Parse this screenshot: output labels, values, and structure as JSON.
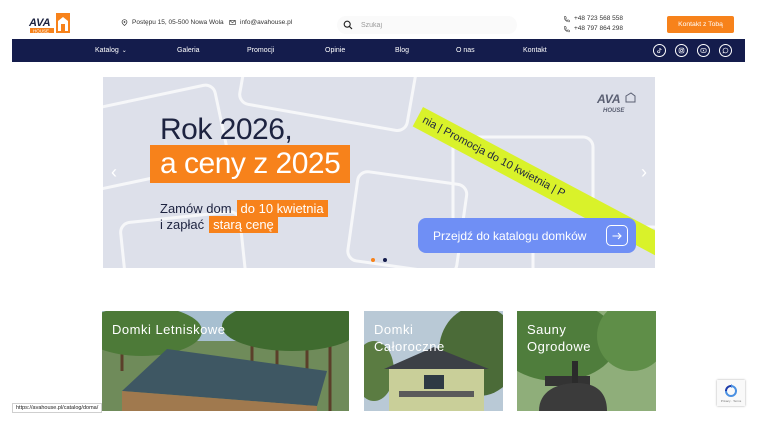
{
  "header": {
    "address": "Postępu 15, 05-500 Nowa Wola",
    "email": "info@avahouse.pl",
    "search_placeholder": "Szukaj",
    "phones": [
      "+48 723 568 558",
      "+48 797 864 298"
    ],
    "cta_label": "Kontakt z Tobą",
    "logo_text": "AVA HOUSE"
  },
  "nav": {
    "items": [
      {
        "label": "Katalog",
        "has_dropdown": true
      },
      {
        "label": "Galeria"
      },
      {
        "label": "Promocji"
      },
      {
        "label": "Opinie"
      },
      {
        "label": "Blog"
      },
      {
        "label": "O nas"
      },
      {
        "label": "Kontakt"
      }
    ],
    "social_icons": [
      "tiktok-icon",
      "instagram-icon",
      "youtube-icon",
      "whatsapp-icon"
    ]
  },
  "hero": {
    "title_line1": "Rok 2026,",
    "title_line2": "a ceny z 2025",
    "sub_line1_a": "Zamów dom",
    "sub_line1_b": "do 10 kwietnia",
    "sub_line2_a": "i zapłać",
    "sub_line2_b": "starą cenę",
    "button_label": "Przejdź do katalogu domków",
    "stripe_text": "nia  |  Promocja do 10 kwietnia  |  P",
    "logo_text": "AVA HOUSE",
    "slides_total": 2,
    "active_slide": 1
  },
  "categories": [
    {
      "label": "Domki Letniskowe"
    },
    {
      "label_line1": "Domki",
      "label_line2": "Całoroczne"
    },
    {
      "label_line1": "Sauny",
      "label_line2": "Ogrodowe"
    }
  ],
  "status_url": "https://avahouse.pl/catalog/doma/",
  "colors": {
    "accent": "#f7821b",
    "nav": "#141c4c",
    "hero_button": "#6f8ff5",
    "stripe": "#d9f22a"
  }
}
